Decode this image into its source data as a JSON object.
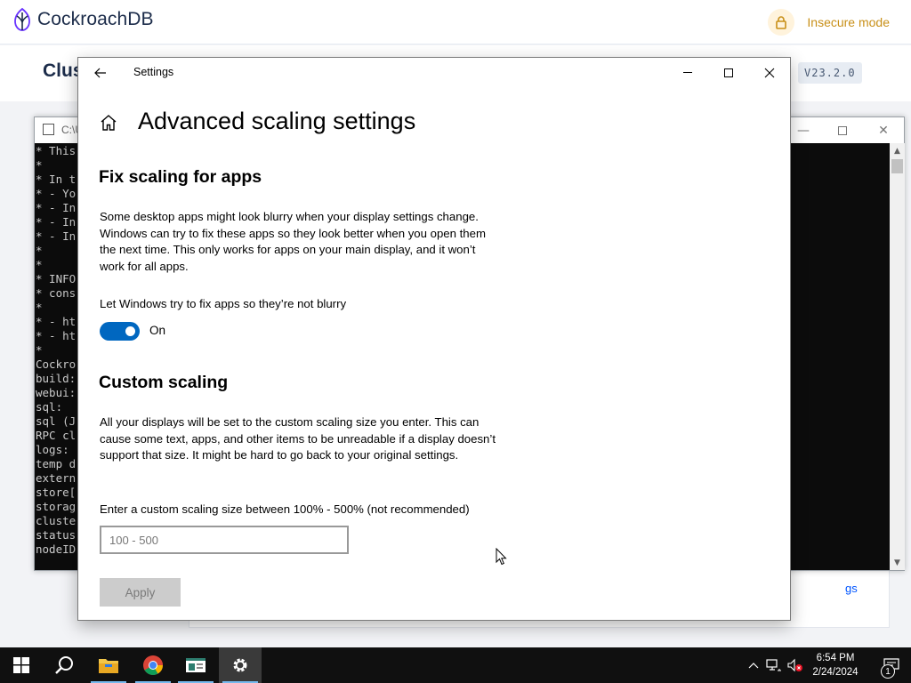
{
  "crdb": {
    "logo_text": "CockroachDB",
    "security_label": "Insecure mode",
    "page_title_visible": "Clus",
    "version": "V23.2.0",
    "card_link_text": "gs"
  },
  "console": {
    "title_fragment": "C:\\U",
    "lines": [
      "* This",
      "*",
      "* In t",
      "* - Yo",
      "* - In",
      "* - In",
      "* - In",
      "*",
      "*",
      "* INFO",
      "* cons",
      "*",
      "* - ht",
      "* - ht",
      "*",
      "Cockro",
      "build:",
      "webui:",
      "sql:",
      "sql (J",
      "RPC cl",
      "logs:",
      "temp d",
      "extern",
      "store[",
      "storag",
      "cluste",
      "status",
      "nodeID"
    ]
  },
  "settings": {
    "window_title": "Settings",
    "heading": "Advanced scaling settings",
    "fix_section_title": "Fix scaling for apps",
    "fix_description": "Some desktop apps might look blurry when your display settings change. Windows can try to fix these apps so they look better when you open them the next time. This only works for apps on your main display, and it won’t work for all apps.",
    "toggle_label": "Let Windows try to fix apps so they’re not blurry",
    "toggle_state": "On",
    "custom_section_title": "Custom scaling",
    "custom_description": "All your displays will be set to the custom scaling size you enter. This can cause some text, apps, and other items to be unreadable if a display doesn’t support that size. It might be hard to go back to your original settings.",
    "input_label": "Enter a custom scaling size between 100% - 500% (not recommended)",
    "input_placeholder": "100 - 500",
    "input_value": "",
    "apply_label": "Apply",
    "toggle_on": true
  },
  "taskbar": {
    "apps": [
      "start-icon",
      "search-icon",
      "file-explorer-icon",
      "chrome-icon",
      "terminal-icon",
      "settings-icon"
    ],
    "active_app": "settings-icon",
    "time": "6:54 PM",
    "date": "2/24/2024",
    "notification_count": "1"
  },
  "colors": {
    "accent": "#0067c0",
    "crdb_navy": "#1c2c4a",
    "insecure": "#c88f17",
    "link_blue": "#0055ff",
    "taskbar": "#101010"
  }
}
